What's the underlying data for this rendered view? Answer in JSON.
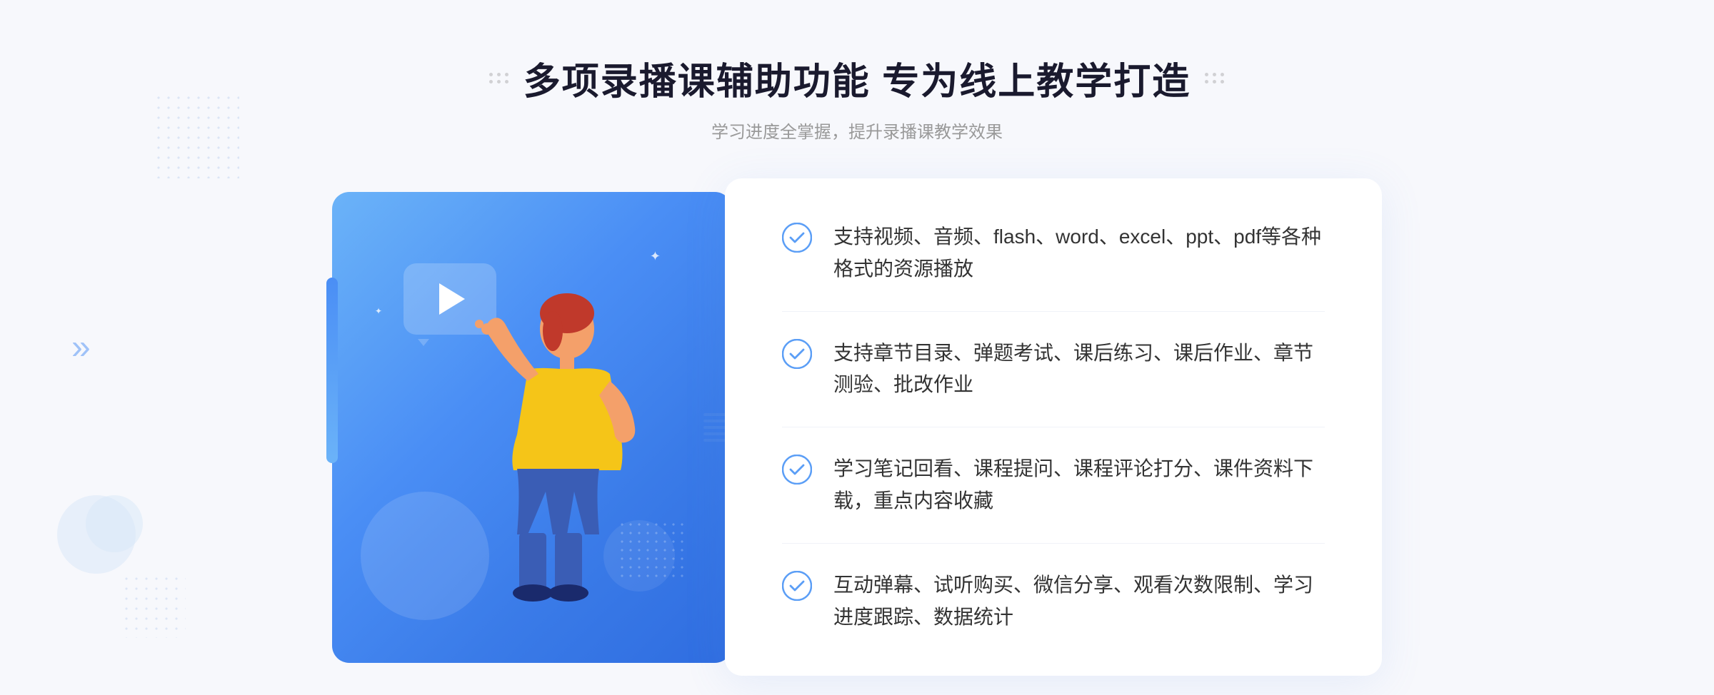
{
  "page": {
    "background_color": "#f7f8fc"
  },
  "header": {
    "title": "多项录播课辅助功能 专为线上教学打造",
    "subtitle": "学习进度全掌握，提升录播课教学效果"
  },
  "features": [
    {
      "id": 1,
      "text": "支持视频、音频、flash、word、excel、ppt、pdf等各种格式的资源播放"
    },
    {
      "id": 2,
      "text": "支持章节目录、弹题考试、课后练习、课后作业、章节测验、批改作业"
    },
    {
      "id": 3,
      "text": "学习笔记回看、课程提问、课程评论打分、课件资料下载，重点内容收藏"
    },
    {
      "id": 4,
      "text": "互动弹幕、试听购买、微信分享、观看次数限制、学习进度跟踪、数据统计"
    }
  ],
  "icons": {
    "check_circle": "✓",
    "chevron": "»",
    "play": "▶"
  },
  "colors": {
    "primary_blue": "#4a8ef5",
    "light_blue": "#6bb3f8",
    "title_color": "#1a1a2e",
    "text_color": "#333333",
    "subtitle_color": "#999999",
    "check_color": "#5b9ef6"
  }
}
